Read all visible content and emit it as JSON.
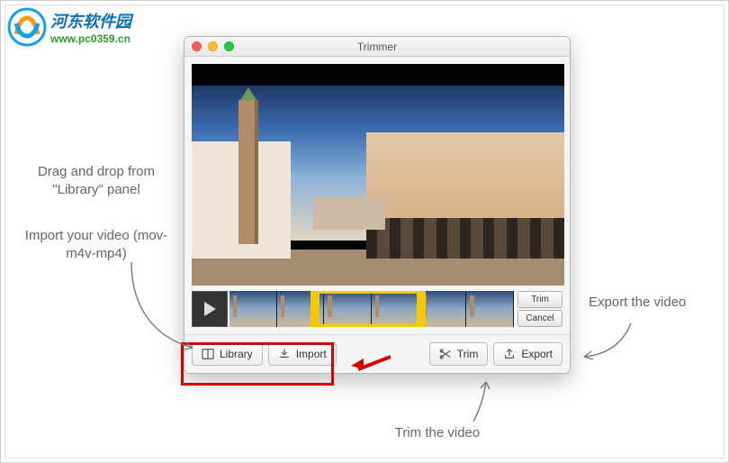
{
  "watermark": {
    "cn": "河东软件园",
    "url": "www.pc0359.cn"
  },
  "window": {
    "title": "Trimmer",
    "timeline": {
      "trim_btn": "Trim",
      "cancel_btn": "Cancel"
    },
    "toolbar": {
      "library": "Library",
      "import": "Import",
      "trim": "Trim",
      "export": "Export"
    }
  },
  "annotations": {
    "drag_drop": "Drag and drop from \"Library\" panel",
    "import_hint": "Import your video (mov-m4v-mp4)",
    "export_hint": "Export the video",
    "trim_hint": "Trim the video"
  }
}
